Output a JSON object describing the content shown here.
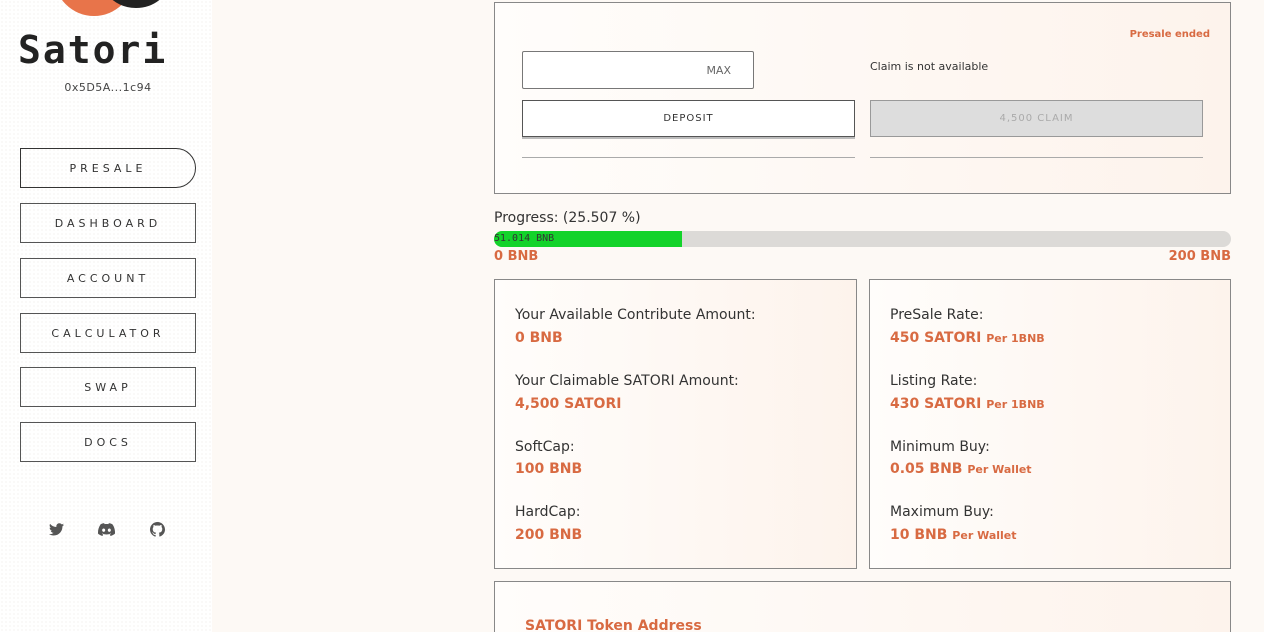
{
  "brand": {
    "name": "Satori",
    "wallet": "0x5D5A...1c94"
  },
  "nav": [
    {
      "label": "PRESALE",
      "active": true
    },
    {
      "label": "DASHBOARD",
      "active": false
    },
    {
      "label": "ACCOUNT",
      "active": false
    },
    {
      "label": "CALCULATOR",
      "active": false
    },
    {
      "label": "SWAP",
      "active": false
    },
    {
      "label": "DOCS",
      "active": false
    }
  ],
  "social": [
    "twitter-icon",
    "discord-icon",
    "github-icon"
  ],
  "presale": {
    "status": "Presale ended",
    "amount_value": "",
    "max_label": "MAX",
    "claim_note": "Claim is not available",
    "deposit_label": "DEPOSIT",
    "claim_label": "4,500 CLAIM"
  },
  "progress": {
    "label": "Progress: (25.507 %)",
    "percent": 25.507,
    "raised_label": "51.014 BNB",
    "min_label": "0 BNB",
    "max_label": "200 BNB"
  },
  "stats_left": [
    {
      "label": "Your Available Contribute Amount:",
      "value": "0 BNB",
      "unit": ""
    },
    {
      "label": "Your Claimable SATORI Amount:",
      "value": "4,500 SATORI",
      "unit": ""
    },
    {
      "label": "SoftCap:",
      "value": "100 BNB",
      "unit": ""
    },
    {
      "label": "HardCap:",
      "value": "200 BNB",
      "unit": ""
    }
  ],
  "stats_right": [
    {
      "label": "PreSale Rate:",
      "value": "450 SATORI",
      "unit": "Per 1BNB"
    },
    {
      "label": "Listing Rate:",
      "value": "430 SATORI",
      "unit": "Per 1BNB"
    },
    {
      "label": "Minimum Buy:",
      "value": "0.05 BNB",
      "unit": "Per Wallet"
    },
    {
      "label": "Maximum Buy:",
      "value": "10 BNB",
      "unit": "Per Wallet"
    }
  ],
  "token": {
    "title": "SATORI Token Address"
  },
  "colors": {
    "accent": "#d86a42",
    "progress": "#13d32a",
    "logo": "#e8744a"
  }
}
